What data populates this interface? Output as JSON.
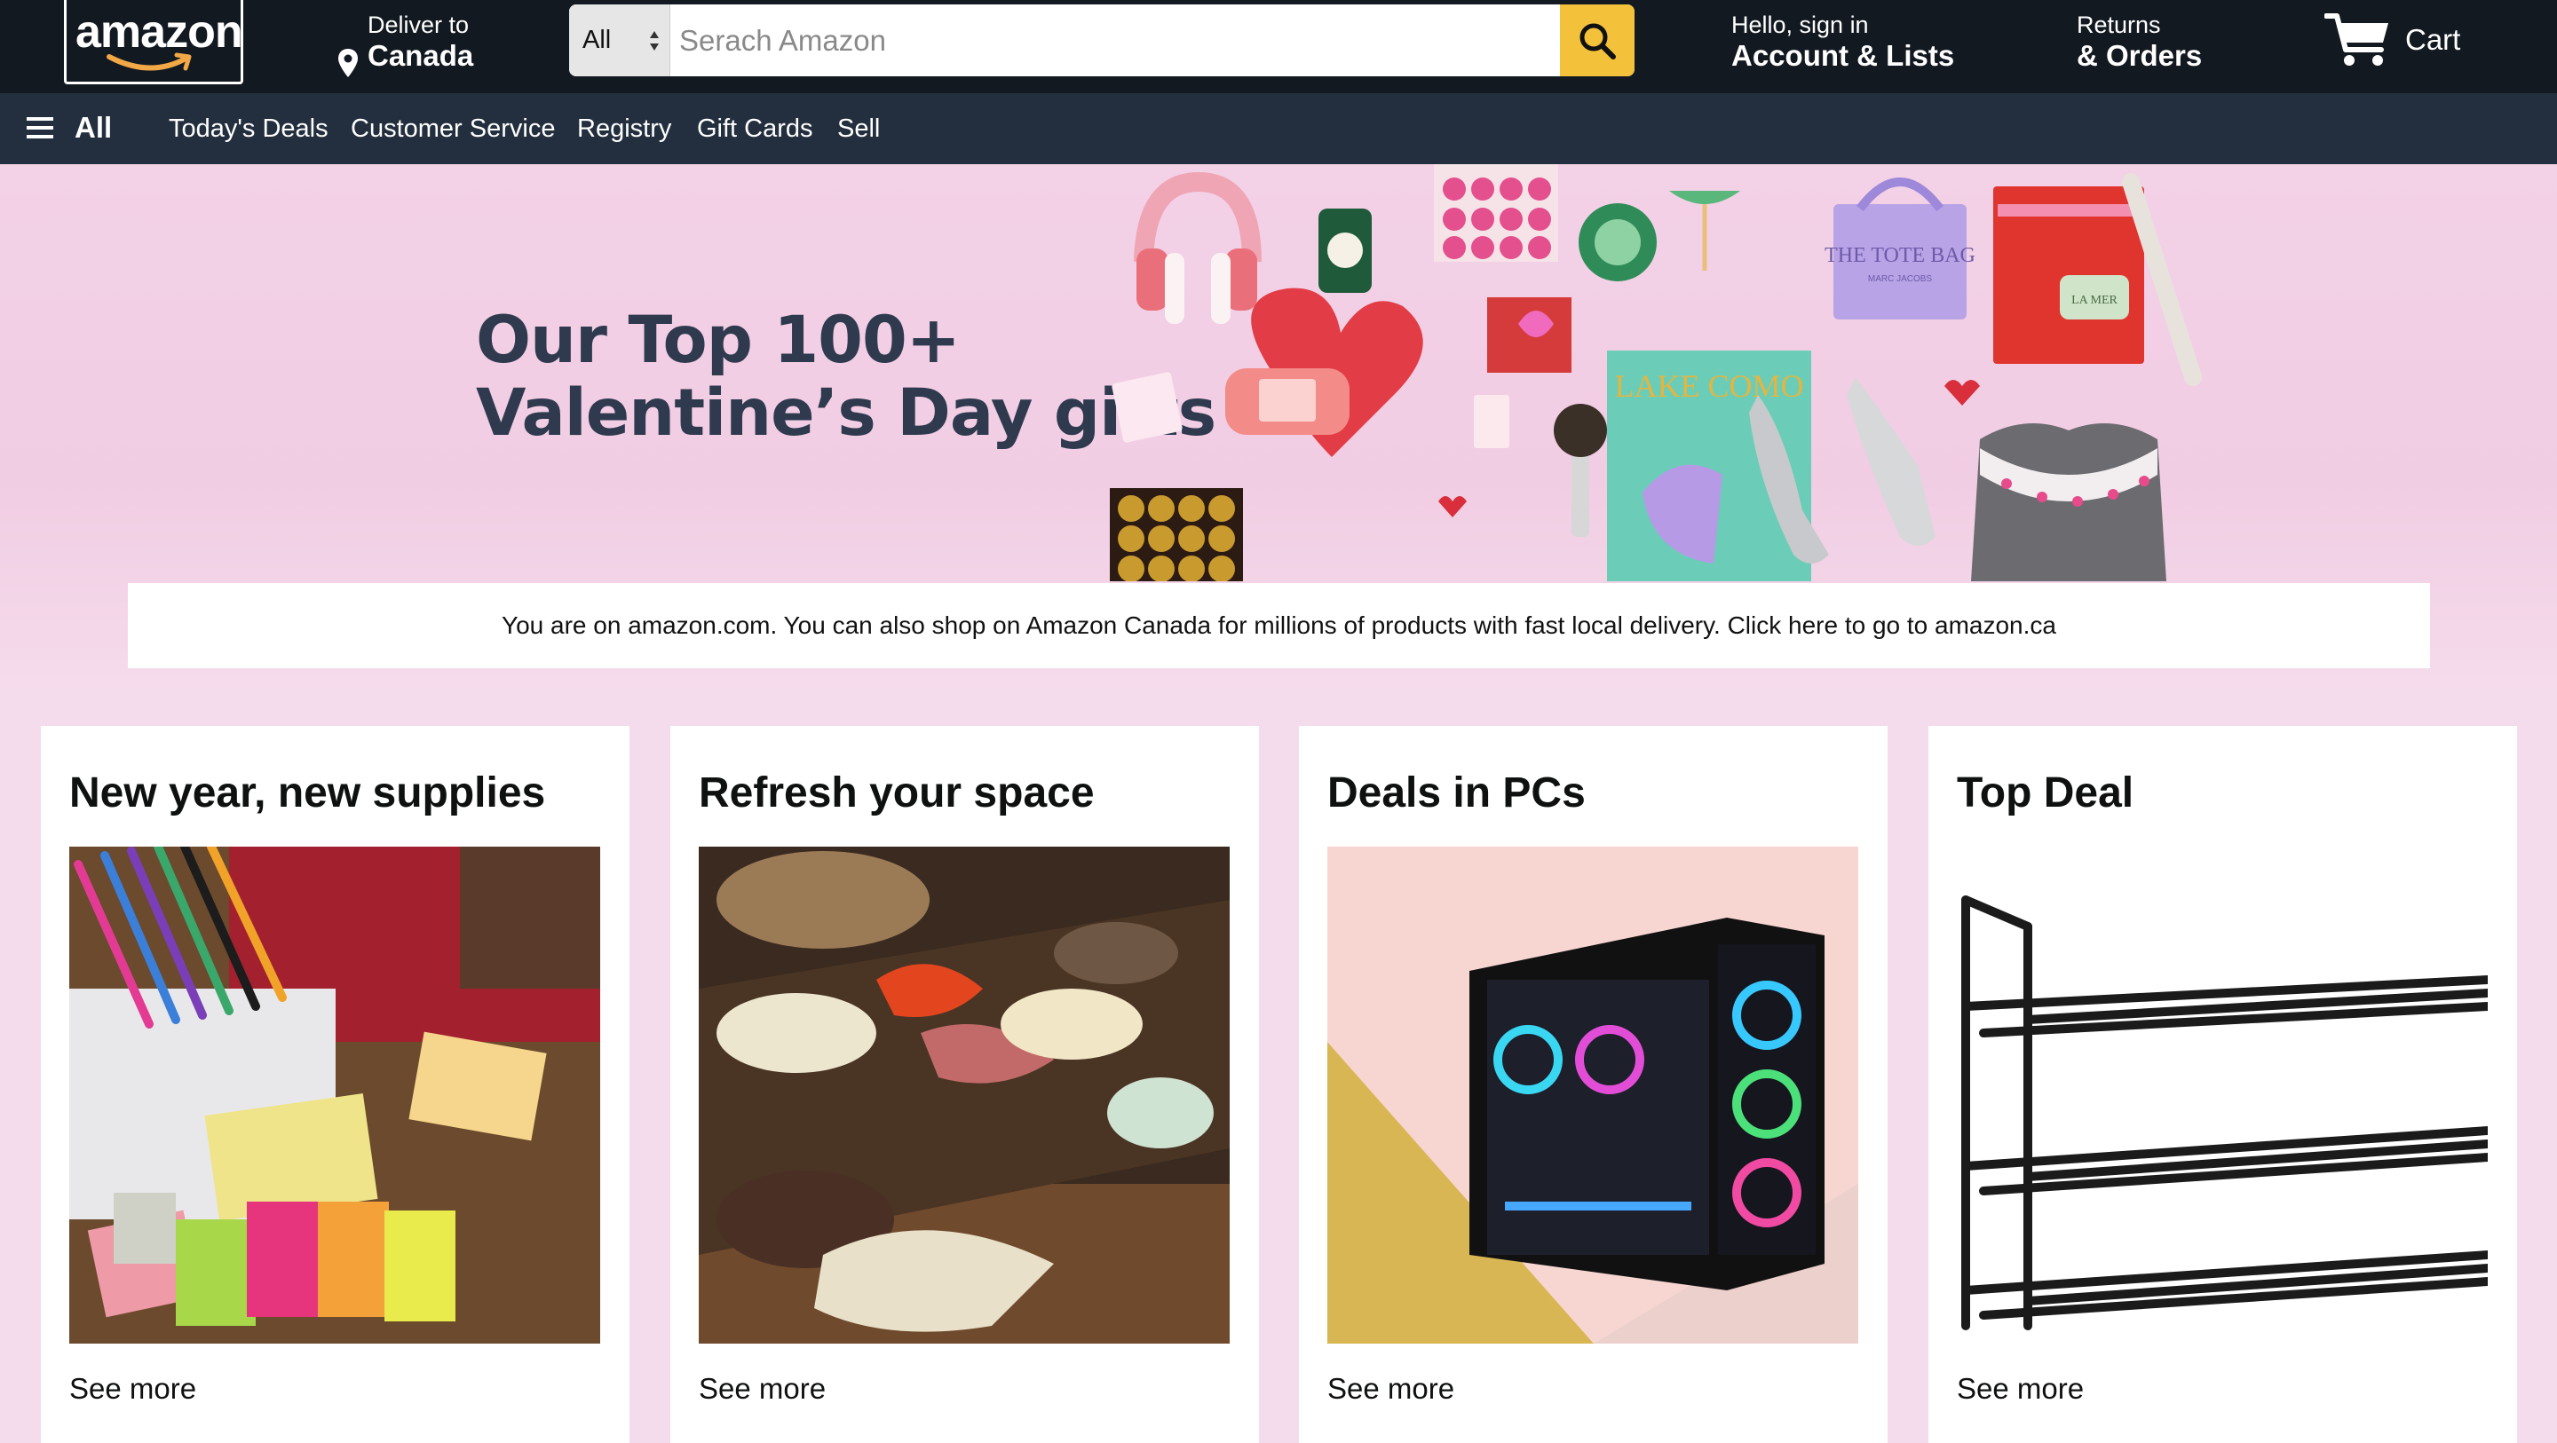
{
  "logo": {
    "text": "amazon"
  },
  "deliver": {
    "line1": "Deliver to",
    "line2": "Canada"
  },
  "search": {
    "category": "All",
    "placeholder": "Serach Amazon",
    "value": ""
  },
  "account": {
    "line1": "Hello, sign in",
    "line2": "Account & Lists"
  },
  "returns": {
    "line1": "Returns",
    "line2": "& Orders"
  },
  "cart": {
    "label": "Cart"
  },
  "subnav": {
    "all_label": "All",
    "links": [
      "Today's Deals",
      "Customer Service",
      "Registry",
      "Gift Cards",
      "Sell"
    ]
  },
  "hero": {
    "title_line1": "Our Top 100+",
    "title_line2": "Valentine’s Day gifts",
    "art_text": {
      "tote": "THE TOTE BAG",
      "tote_brand": "MARC JACOBS",
      "book": "LAKE COMO",
      "cream": "LA MER"
    }
  },
  "notice": {
    "text": "You are on amazon.com. You can also shop on Amazon Canada for millions of products with fast local delivery. Click here to go to amazon.ca"
  },
  "cards": [
    {
      "title": "New year, new supplies",
      "link": "See more",
      "image": "office-supplies-image"
    },
    {
      "title": "Refresh your space",
      "link": "See more",
      "image": "charcuterie-board-image"
    },
    {
      "title": "Deals in PCs",
      "link": "See more",
      "image": "gaming-pc-image"
    },
    {
      "title": "Top Deal",
      "link": "See more",
      "image": "shoe-rack-image"
    }
  ],
  "colors": {
    "nav": "#131921",
    "subnav": "#232f3e",
    "search_button": "#f3c13a",
    "hero_bg": "#f3d1e6",
    "title": "#2f3a4f"
  }
}
